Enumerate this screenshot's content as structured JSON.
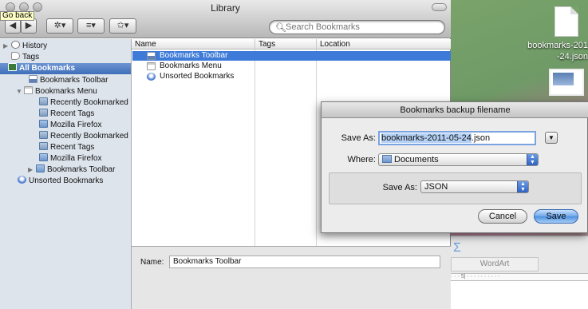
{
  "window": {
    "title": "Library"
  },
  "toolbar": {
    "back_label": "◀",
    "forward_label": "▶",
    "organize_label": "✲▾",
    "views_label": "≡▾",
    "import_label": "✩▾",
    "tooltip": "Go back",
    "search_placeholder": "Search Bookmarks"
  },
  "sidebar": {
    "items": [
      {
        "label": "History"
      },
      {
        "label": "Tags"
      },
      {
        "label": "All Bookmarks"
      },
      {
        "label": "Bookmarks Toolbar"
      },
      {
        "label": "Bookmarks Menu"
      },
      {
        "label": "Recently Bookmarked"
      },
      {
        "label": "Recent Tags"
      },
      {
        "label": "Mozilla Firefox"
      },
      {
        "label": "Recently Bookmarked"
      },
      {
        "label": "Recent Tags"
      },
      {
        "label": "Mozilla Firefox"
      },
      {
        "label": "Bookmarks Toolbar"
      },
      {
        "label": "Unsorted Bookmarks"
      }
    ]
  },
  "list": {
    "columns": [
      "Name",
      "Tags",
      "Location"
    ],
    "rows": [
      {
        "name": "Bookmarks Toolbar"
      },
      {
        "name": "Bookmarks Menu"
      },
      {
        "name": "Unsorted Bookmarks"
      }
    ]
  },
  "detail": {
    "name_label": "Name:",
    "name_value": "Bookmarks Toolbar"
  },
  "dialog": {
    "title": "Bookmarks backup filename",
    "save_as_label": "Save As:",
    "filename": "bookmarks-2011-05-24",
    "extension": ".json",
    "where_label": "Where:",
    "where_value": "Documents",
    "format_label": "Save As:",
    "format_value": "JSON",
    "cancel_label": "Cancel",
    "save_label": "Save"
  },
  "desktop": {
    "file_label_1": "bookmarks-201",
    "file_label_2": "-24.json"
  },
  "word": {
    "tab_label": "WordArt",
    "sigma": "Σ",
    "ruler_text": "· · · 5| · · · · · · · · · ·"
  },
  "colors": {
    "selection": "#3e7bd8",
    "sidebar": "#dde4ec",
    "default_button": "#4c8fe0"
  }
}
